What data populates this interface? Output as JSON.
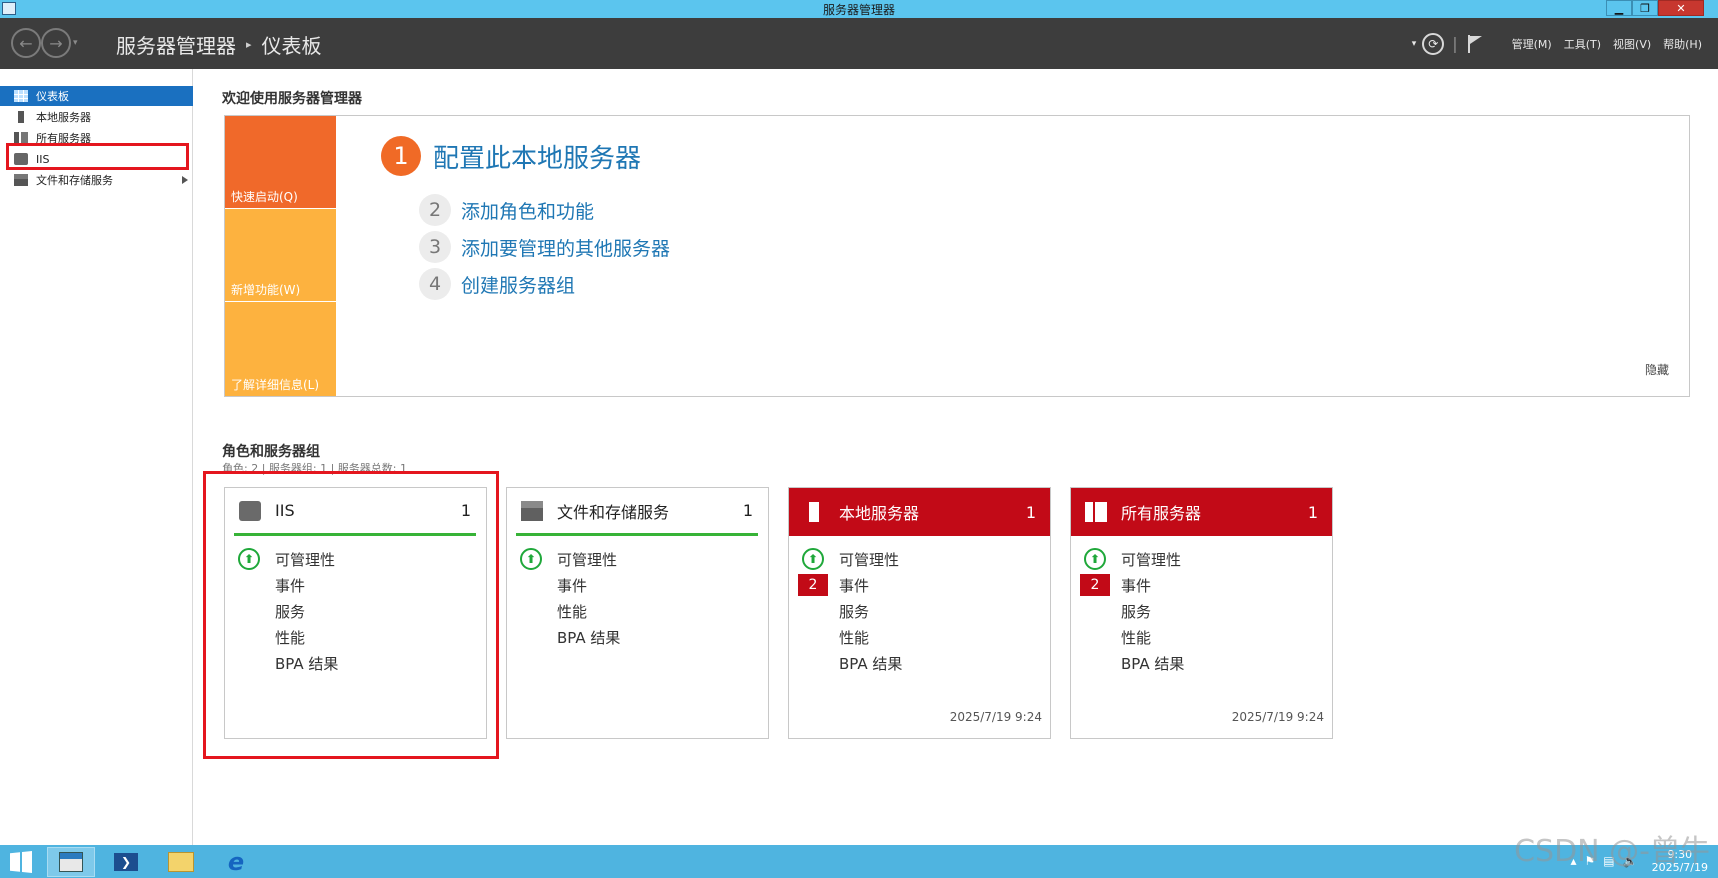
{
  "window": {
    "title": "服务器管理器",
    "min_icon": "minimize-icon",
    "max_icon": "restore-icon",
    "close_icon": "close-icon",
    "min_glyph": "▁",
    "max_glyph": "❐",
    "close_glyph": "✕"
  },
  "header": {
    "breadcrumb_root": "服务器管理器",
    "breadcrumb_sep": "▸",
    "breadcrumb_current": "仪表板",
    "dropdown_glyph": "▾",
    "refresh_glyph": "⟳",
    "pipe": "|",
    "menus": [
      "管理(M)",
      "工具(T)",
      "视图(V)",
      "帮助(H)"
    ]
  },
  "sidebar": {
    "items": [
      {
        "label": "仪表板"
      },
      {
        "label": "本地服务器"
      },
      {
        "label": "所有服务器"
      },
      {
        "label": "IIS"
      },
      {
        "label": "文件和存储服务"
      }
    ]
  },
  "welcome": {
    "title": "欢迎使用服务器管理器",
    "tiles": [
      "快速启动(Q)",
      "新增功能(W)",
      "了解详细信息(L)"
    ],
    "steps": [
      {
        "num": "1",
        "label": "配置此本地服务器"
      },
      {
        "num": "2",
        "label": "添加角色和功能"
      },
      {
        "num": "3",
        "label": "添加要管理的其他服务器"
      },
      {
        "num": "4",
        "label": "创建服务器组"
      }
    ],
    "hide": "隐藏"
  },
  "roles": {
    "title": "角色和服务器组",
    "subtitle": "角色: 2 | 服务器组: 1 | 服务器总数: 1",
    "ok_glyph": "⬆",
    "cards": [
      {
        "name": "IIS",
        "count": "1",
        "rows": [
          "可管理性",
          "事件",
          "服务",
          "性能",
          "BPA 结果"
        ],
        "time": ""
      },
      {
        "name": "文件和存储服务",
        "count": "1",
        "rows": [
          "可管理性",
          "事件",
          "性能",
          "BPA 结果"
        ],
        "time": ""
      },
      {
        "name": "本地服务器",
        "count": "1",
        "rows": [
          "可管理性",
          "事件",
          "服务",
          "性能",
          "BPA 结果"
        ],
        "events_badge": "2",
        "time": "2025/7/19 9:24"
      },
      {
        "name": "所有服务器",
        "count": "1",
        "rows": [
          "可管理性",
          "事件",
          "服务",
          "性能",
          "BPA 结果"
        ],
        "events_badge": "2",
        "time": "2025/7/19 9:24"
      }
    ]
  },
  "taskbar": {
    "clock_time": "9:30",
    "clock_date": "2025/7/19",
    "tray_glyphs": [
      "▴",
      "⚑",
      "▤",
      "🔈"
    ],
    "app_glyphs": {
      "powershell": "❯",
      "explorer": "▭",
      "ie": "e"
    }
  },
  "watermark": "CSDN @-曾牛",
  "colors": {
    "titlebar": "#5bc5ee",
    "header": "#3d3d3d",
    "accent_blue": "#1a70c0",
    "orange": "#f0692a",
    "amber": "#fdb23f",
    "alert_red": "#c20a17",
    "ok_green": "#1fa83a",
    "highlight_red": "#e4161e"
  }
}
